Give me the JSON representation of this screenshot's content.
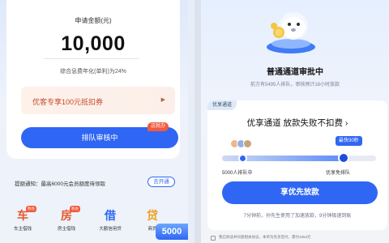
{
  "left_screen": {
    "apply_label": "申请金额(元)",
    "apply_amount": "10,000",
    "rate_text": "综合息费年化(单利)为24%",
    "coupon_banner": {
      "text": "优客专享100元抵扣券",
      "arrow": "▶"
    },
    "queue_button": {
      "label": "排队审核中",
      "tag": "这就办"
    },
    "notice": {
      "text": "提额通知：最高6000元会员额度待领取",
      "button": "去开通"
    },
    "loan_items": [
      {
        "glyph": "车",
        "badge": "秒办",
        "label": "车主借钱",
        "color": "#e4572e"
      },
      {
        "glyph": "房",
        "badge": "秒办",
        "label": "房主借钱",
        "color": "#e4572e"
      },
      {
        "glyph": "借",
        "badge": "",
        "label": "大额信用贷",
        "color": "#2f66f4"
      },
      {
        "glyph": "贷",
        "badge": "",
        "label": "商贷",
        "color": "#f0a020"
      }
    ],
    "float_chip": "5000"
  },
  "right_screen": {
    "review_title": "普通通道审批中",
    "review_sub": "前方有5495人排队，审核预计18小时放款",
    "priority_tag": "优享通道",
    "priority_title": "优享通道 放款失败不扣费 ›",
    "fastest_badge": "最快30秒",
    "progress": {
      "fill_fraction": 0.8
    },
    "label_left": "5000人排队中",
    "label_right": "优享免排队",
    "priority_button": "享优先放款",
    "priority_note": "7分钟前，孙先生使用了加速放款，9分钟极速到账",
    "agree_text": "我已阅读并同意相关协议，本单为先享后付，需付1053元"
  }
}
